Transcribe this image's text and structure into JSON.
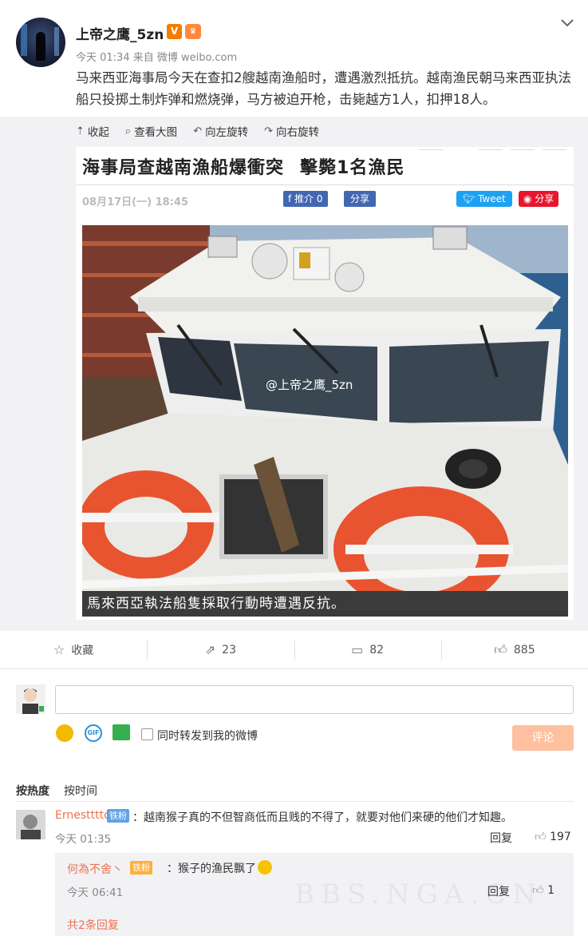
{
  "post": {
    "username": "上帝之鹰_5zn",
    "verified_badge": "V",
    "meta": "今天 01:34 来自 微博 weibo.com",
    "text": "马来西亚海事局今天在查扣2艘越南渔船时，遭遇激烈抵抗。越南渔民朝马来西亚执法船只投掷土制炸弹和燃烧弹，马方被迫开枪，击毙越方1人，扣押18人。"
  },
  "media_tools": {
    "collapse": "收起",
    "view_large": "查看大图",
    "rotate_left": "向左旋转",
    "rotate_right": "向右旋转"
  },
  "article": {
    "title_part1": "海事局查越南漁船爆衝突",
    "title_part2": "擊斃1名漁民",
    "date": "08月17日(一) 18:45",
    "fb_label": "推介 0",
    "share_label": "分享",
    "tweet_label": "Tweet",
    "weibo_share_label": "分享",
    "watermark": "@上帝之鹰_5zn",
    "caption": "馬來西亞執法船隻採取行動時遭遇反抗。"
  },
  "actions": {
    "favorite": "收藏",
    "reposts": "23",
    "comments": "82",
    "likes": "885"
  },
  "compose": {
    "sync_label": "同时转发到我的微博",
    "submit": "评论"
  },
  "sort": {
    "by_hot": "按热度",
    "by_time": "按时间"
  },
  "comment": {
    "user": "Ernestttto",
    "tag": "铁粉",
    "text": "：越南猴子真的不但智商低而且贱的不得了，就要对他们来硬的他们才知趣。",
    "time": "今天 01:35",
    "reply": "回复",
    "likes": "197"
  },
  "reply": {
    "user": "何為不舍丶",
    "tag": "铁粉",
    "text": "：猴子的渔民飘了",
    "time": "今天 06:41",
    "reply": "回复",
    "likes": "1",
    "more": "共2条回复"
  },
  "site_watermark": "BBS.NGA.CN"
}
